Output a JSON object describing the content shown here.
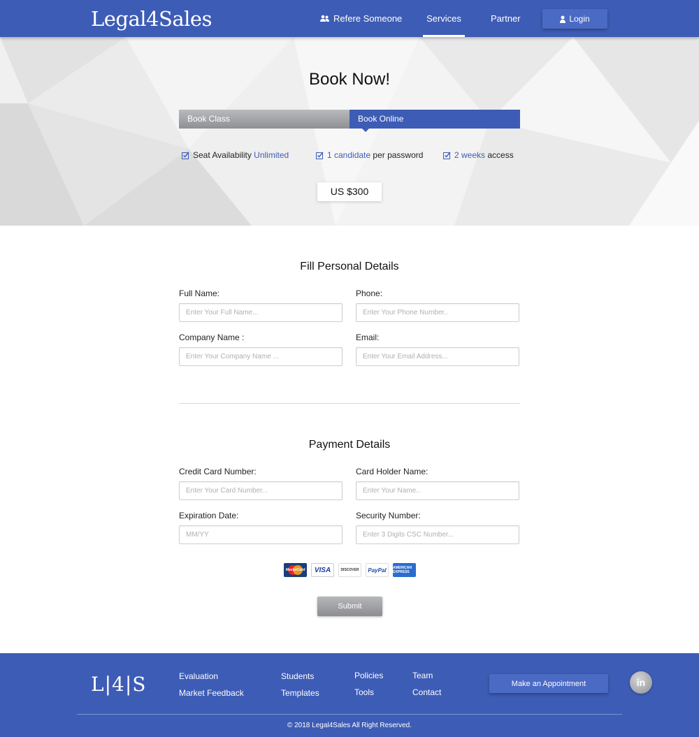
{
  "header": {
    "logo": "Legal4Sales",
    "nav": {
      "refer": "Refere Someone",
      "services": "Services",
      "partner": "Partner",
      "login": "Login"
    }
  },
  "hero": {
    "title": "Book Now!",
    "tabs": {
      "book_class": "Book Class",
      "book_online": "Book Online",
      "active": "Book Online"
    },
    "features": [
      {
        "prefix": "Seat Availability ",
        "highlight": "Unlimited",
        "suffix": ""
      },
      {
        "prefix": "",
        "highlight": "1 candidate",
        "suffix": " per password"
      },
      {
        "prefix": "",
        "highlight": "2 weeks",
        "suffix": " access"
      }
    ],
    "price": "US $300"
  },
  "personal": {
    "title": "Fill Personal Details",
    "full_name": {
      "label": "Full Name:",
      "placeholder": "Enter Your Full Name..."
    },
    "phone": {
      "label": "Phone:",
      "placeholder": "Enter Your Phone Number.."
    },
    "company": {
      "label": "Company Name :",
      "placeholder": "Enter Your Company Name ..."
    },
    "email": {
      "label": "Email:",
      "placeholder": "Enter Your Email Address..."
    }
  },
  "payment": {
    "title": "Payment Details",
    "card_number": {
      "label": "Credit Card Number:",
      "placeholder": "Enter Your Card Number..."
    },
    "holder": {
      "label": "Card Holder Name:",
      "placeholder": "Enter Your Name.."
    },
    "expiry": {
      "label": "Expiration Date:",
      "placeholder": "MM/YY"
    },
    "security": {
      "label": "Security Number:",
      "placeholder": "Enter 3 Digits CSC Number..."
    },
    "card_logos": [
      "MasterCard",
      "VISA",
      "DISCOVER",
      "PayPal",
      "AMERICAN EXPRESS"
    ],
    "submit": "Submit"
  },
  "footer": {
    "logo": "L|4|S",
    "links_col1": [
      "Evaluation",
      "Market Feedback"
    ],
    "links_col2": [
      "Students",
      "Templates"
    ],
    "links_col3": [
      "Policies",
      "Tools"
    ],
    "links_col4": [
      "Team",
      "Contact"
    ],
    "appointment": "Make an Appointment",
    "social": "in",
    "copyright": "© 2018 Legal4Sales All Right Reserved."
  },
  "colors": {
    "brand": "#3d5cb5",
    "button": "#4a6ac4",
    "gray_button": "#8f9094"
  },
  "icons": [
    "users-icon",
    "user-icon",
    "checkbox-icon",
    "linkedin-icon"
  ]
}
